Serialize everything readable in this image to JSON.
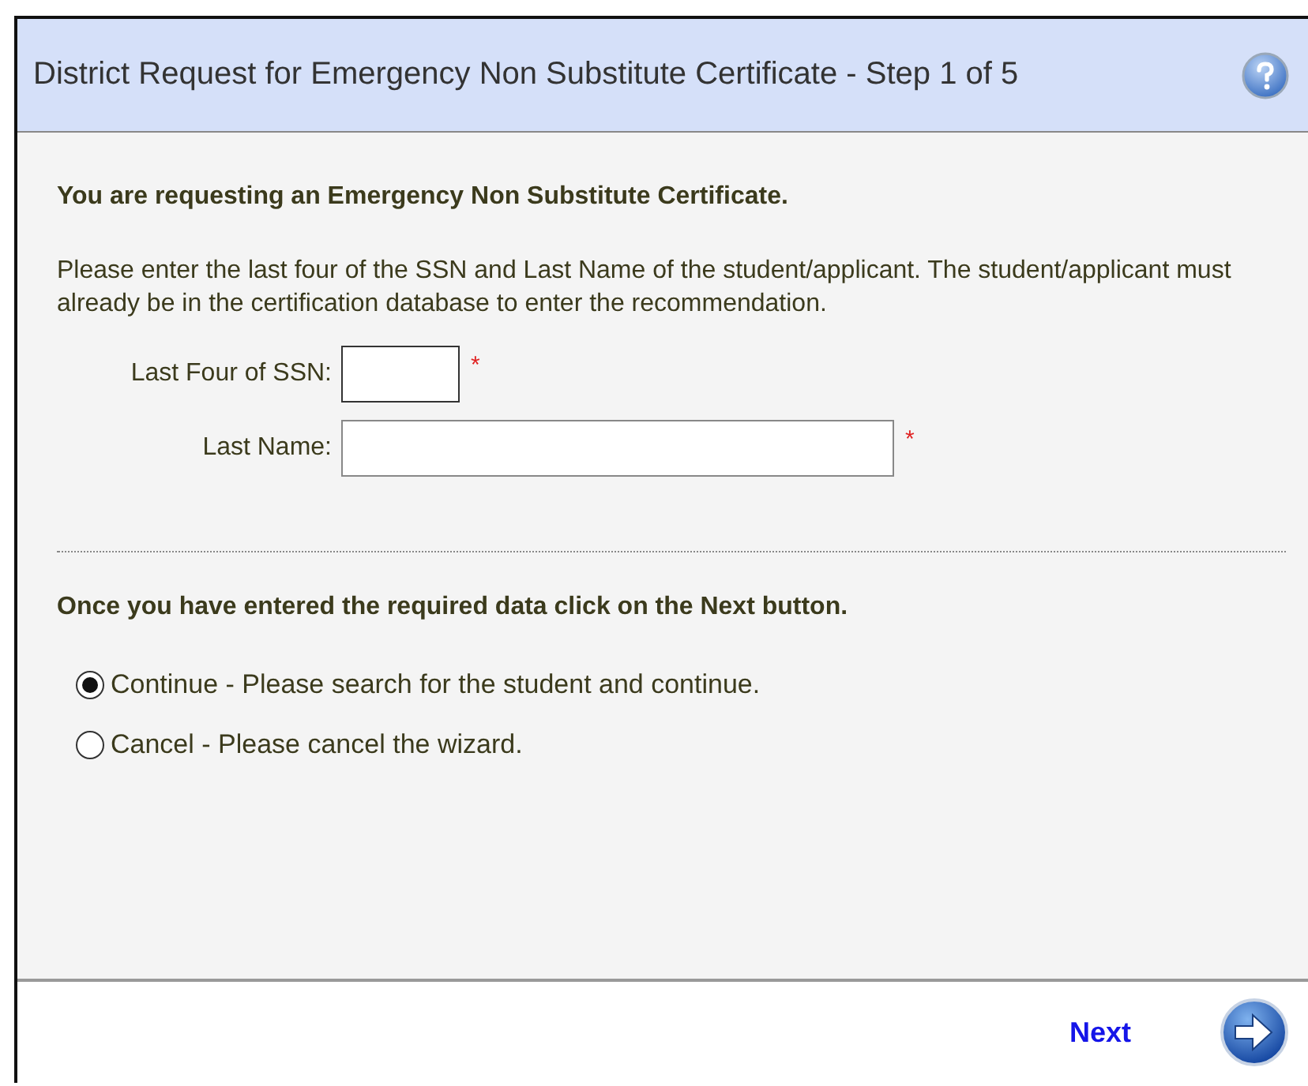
{
  "header": {
    "title": "District Request for Emergency Non Substitute Certificate - Step 1 of 5"
  },
  "intro": "You are requesting an Emergency Non Substitute Certificate.",
  "instructions": "Please enter the last four of the SSN and Last Name of the student/applicant. The student/applicant must already be in the certification database to enter the recommendation.",
  "fields": [
    {
      "label": "Last Four of SSN:",
      "required_mark": "*",
      "kind": "short"
    },
    {
      "label": "Last Name:",
      "required_mark": "*",
      "kind": "long"
    }
  ],
  "prompt": "Once you have entered the required data click on the Next button.",
  "options": [
    {
      "label": "Continue - Please search for the student and continue.",
      "selected": true
    },
    {
      "label": "Cancel - Please cancel the wizard.",
      "selected": false
    }
  ],
  "footer": {
    "next_label": "Next"
  }
}
